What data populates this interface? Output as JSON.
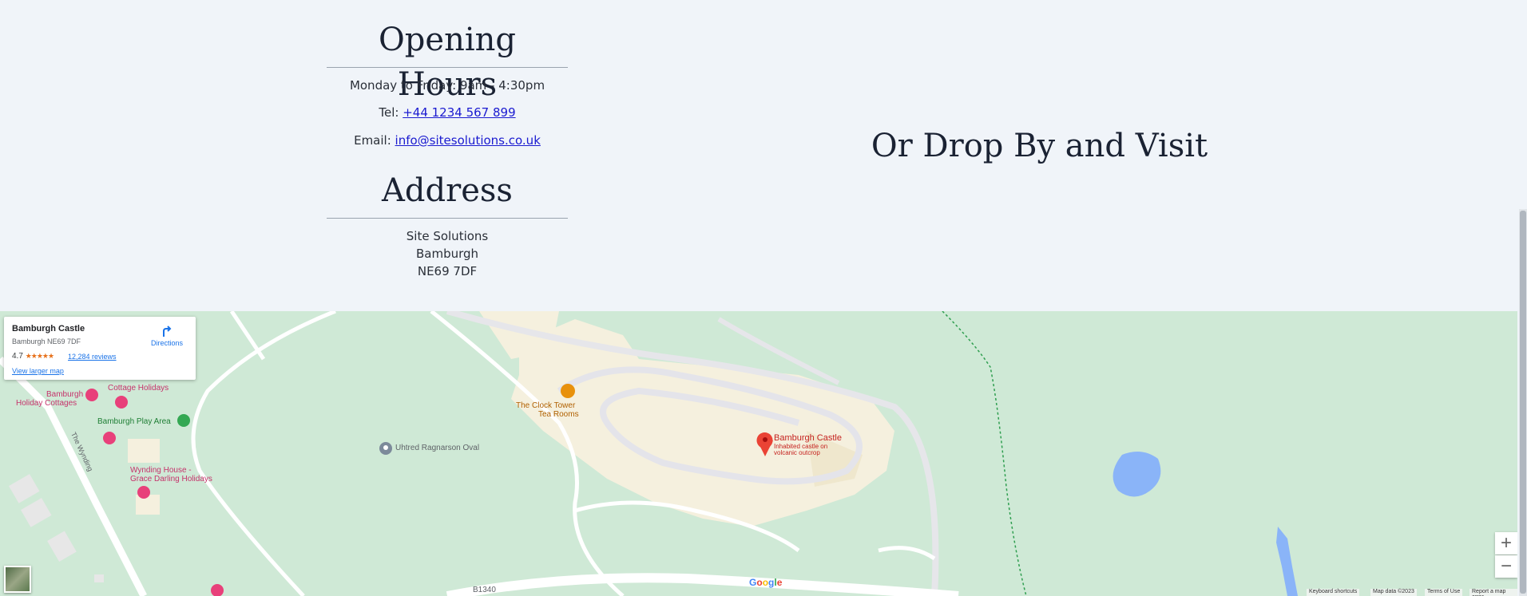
{
  "opening_hours": {
    "title": "Opening Hours",
    "hours": "Monday to Friday: 9am - 4:30pm",
    "tel_label": "Tel:",
    "tel": "+44 1234 567 899",
    "email_label": "Email:",
    "email": "info@sitesolutions.co.uk"
  },
  "address": {
    "title": "Address",
    "line1": "Site Solutions",
    "line2": "Bamburgh",
    "line3": "NE69 7DF"
  },
  "visit": {
    "title": "Or Drop By and Visit"
  },
  "map": {
    "card": {
      "name": "Bamburgh Castle",
      "address": "Bamburgh NE69 7DF",
      "rating": "4.7",
      "stars": "★★★★★",
      "reviews": "12,284 reviews",
      "directions": "Directions",
      "larger_map": "View larger map"
    },
    "labels": {
      "holiday_cottages_1": "Bamburgh",
      "holiday_cottages_2": "Holiday Cottages",
      "cottage_holidays": "Cottage Holidays",
      "play_area": "Bamburgh Play Area",
      "the_wynding": "The Wynding",
      "wynding_house_1": "Wynding House -",
      "wynding_house_2": "Grace Darling Holidays",
      "oval": "Uhtred Ragnarson Oval",
      "tea_1": "The Clock Tower",
      "tea_2": "Tea Rooms",
      "castle": "Bamburgh Castle",
      "castle_sub_1": "Inhabited castle on",
      "castle_sub_2": "volcanic outcrop",
      "road": "B1340"
    },
    "zoom_in": "+",
    "zoom_out": "−",
    "google": "Google",
    "attribution": {
      "shortcuts": "Keyboard shortcuts",
      "data": "Map data ©2023",
      "terms": "Terms of Use",
      "report": "Report a map error"
    },
    "colors": {
      "park": "#cfe9d6",
      "building": "#f5f0de",
      "road": "#ffffff",
      "water": "#8ab4f8",
      "pin": "#ea4335",
      "poi_pink": "#e8407a",
      "poi_green": "#34a853",
      "poi_orange": "#e8910c",
      "text_link": "#1a73e8"
    }
  }
}
